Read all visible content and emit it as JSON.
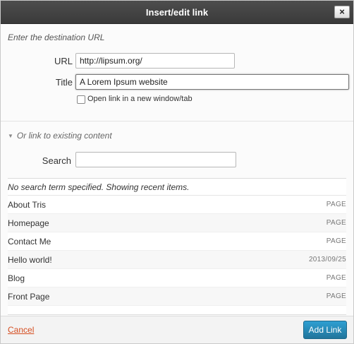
{
  "dialog": {
    "title": "Insert/edit link",
    "close_label": "×"
  },
  "destination": {
    "intro": "Enter the destination URL",
    "url_label": "URL",
    "url_value": "http://lipsum.org/",
    "title_label": "Title",
    "title_value": "A Lorem Ipsum website",
    "new_tab_label": "Open link in a new window/tab",
    "new_tab_checked": false
  },
  "existing": {
    "toggle_label": "Or link to existing content",
    "search_label": "Search",
    "search_value": "",
    "notice": "No search term specified. Showing recent items.",
    "items": [
      {
        "title": "About Tris",
        "type": "PAGE"
      },
      {
        "title": "Homepage",
        "type": "PAGE"
      },
      {
        "title": "Contact Me",
        "type": "PAGE"
      },
      {
        "title": "Hello world!",
        "type": "2013/09/25"
      },
      {
        "title": "Blog",
        "type": "PAGE"
      },
      {
        "title": "Front Page",
        "type": "PAGE"
      }
    ]
  },
  "footer": {
    "cancel_label": "Cancel",
    "submit_label": "Add Link"
  },
  "colors": {
    "titlebar": "#3a3a3a",
    "cancel": "#d54e21",
    "primary_button": "#2e9fd2"
  }
}
